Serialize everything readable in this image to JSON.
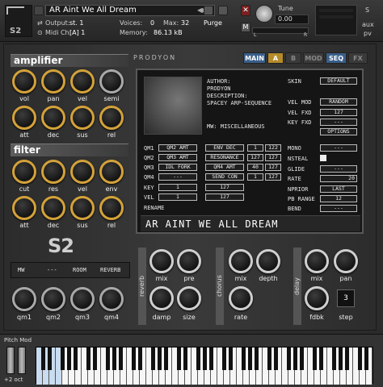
{
  "header": {
    "title": "AR Aint We All Dream",
    "output_label": "Output:",
    "output_value": "st. 1",
    "midi_label": "Midi Ch:",
    "midi_value": "[A] 1",
    "voices_label": "Voices:",
    "voices_value": "0",
    "max_label": "Max:",
    "max_value": "32",
    "memory_label": "Memory:",
    "memory_value": "86.13 kB",
    "purge_label": "Purge",
    "tune_label": "Tune",
    "tune_value": "0.00",
    "s_label": "S",
    "m_label": "M",
    "aux_label": "aux",
    "pv_label": "pv",
    "lr_l": "L",
    "lr_r": "R"
  },
  "brand": "PRODYON",
  "tabs": [
    "MAIN",
    "A",
    "B",
    "MOD",
    "SEQ",
    "FX"
  ],
  "amplifier": {
    "title": "amplifier",
    "knobs": [
      "vol",
      "pan",
      "vel",
      "semi",
      "att",
      "dec",
      "sus",
      "rel"
    ]
  },
  "filter": {
    "title": "filter",
    "knobs": [
      "cut",
      "res",
      "vel",
      "env",
      "att",
      "dec",
      "sus",
      "rel"
    ]
  },
  "screen": {
    "author_label": "AUTHOR:",
    "author": "PRODYON",
    "desc_label": "DESCRIPTION:",
    "desc": "SPACEY ARP-SEQUENCE",
    "mw_label": "MW: MISCELLANEOUS",
    "skin_label": "SKIN",
    "skin_value": "DEFAULT",
    "velmod_label": "VEL MOD",
    "velmod_value": "RANDOM",
    "velfxd_label": "VEL FXD",
    "velfxd_value": "127",
    "keyfxd_label": "KEY FXD",
    "keyfxd_value": "---",
    "options_label": "OPTIONS",
    "qm_rows": [
      {
        "label": "QM1",
        "a": "QM2 AMT",
        "b": "ENV DEC",
        "c": "1",
        "d": "122"
      },
      {
        "label": "QM2",
        "a": "QM3 AMT",
        "b": "RESONANCE",
        "c": "127",
        "d": "127"
      },
      {
        "label": "QM3",
        "a": "IDL FORK",
        "b": "QM4 AMT",
        "c": "40",
        "d": "127"
      },
      {
        "label": "QM4",
        "a": "---",
        "b": "SEND CON",
        "c": "1",
        "d": "127"
      }
    ],
    "key_label": "KEY",
    "key_a": "1",
    "key_b": "127",
    "vel_label": "VEL",
    "vel_a": "1",
    "vel_b": "127",
    "rename_label": "RENAME",
    "mono_label": "MONO",
    "mono_value": "---",
    "nsteal_label": "NSTEAL",
    "glide_label": "GLIDE",
    "glide_value": "---",
    "rate_label": "RATE",
    "rate_value": "20",
    "nprior_label": "NPRIOR",
    "nprior_value": "LAST",
    "pbrange_label": "PB RANGE",
    "pbrange_value": "12",
    "bend_label": "BEND",
    "bend_value": "---",
    "preset_name": "AR AINT WE ALL DREAM"
  },
  "qm_strip": [
    "MW",
    "---",
    "ROOM",
    "REVERB"
  ],
  "qm_knobs": [
    "qm1",
    "qm2",
    "qm3",
    "qm4"
  ],
  "fx": {
    "reverb": {
      "title": "reverb",
      "knobs": [
        "mix",
        "pre",
        "damp",
        "size"
      ]
    },
    "chorus": {
      "title": "chorus",
      "knobs": [
        "mix",
        "depth",
        "rate"
      ]
    },
    "delay": {
      "title": "delay",
      "knobs": [
        "mix",
        "pan",
        "fdbk",
        "step"
      ],
      "step_value": "3"
    }
  },
  "footer": {
    "pitch_mod": "Pitch Mod",
    "octave": "+2 oct"
  }
}
